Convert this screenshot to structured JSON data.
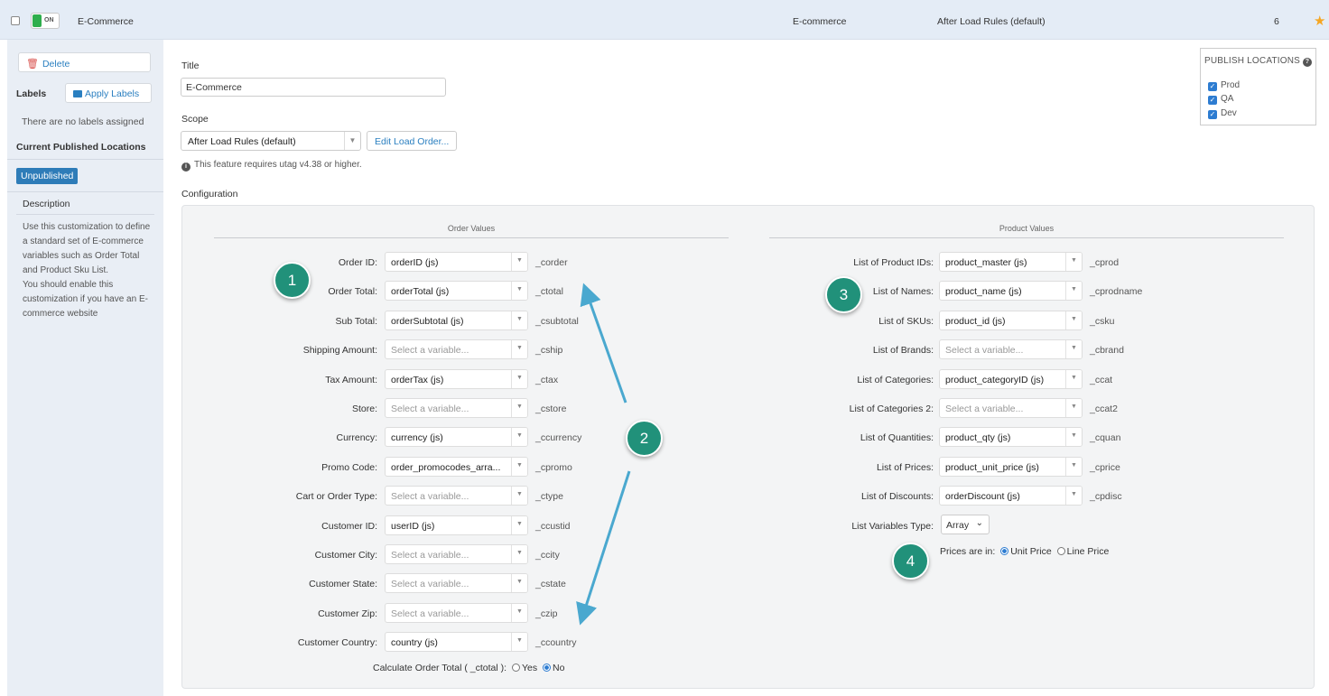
{
  "header": {
    "toggle_label": "ON",
    "name": "E-Commerce",
    "type": "E-commerce",
    "scope": "After Load Rules (default)",
    "number": "6",
    "star_icon": "star-icon"
  },
  "sidebar": {
    "delete_label": "Delete",
    "labels_heading": "Labels",
    "apply_labels": "Apply Labels",
    "no_labels": "There are no labels assigned",
    "current_locations_heading": "Current Published Locations",
    "status_badge": "Unpublished",
    "description_heading": "Description",
    "description": "Use this customization to define a standard set of E-commerce variables such as Order Total and Product Sku List.\nYou should enable this customization if you have an E-commerce website"
  },
  "main": {
    "title_label": "Title",
    "title_value": "E-Commerce",
    "scope_label": "Scope",
    "scope_value": "After Load Rules (default)",
    "edit_load_order": "Edit Load Order...",
    "requirement_note": "This feature requires utag v4.38 or higher.",
    "configuration_label": "Configuration"
  },
  "publish": {
    "title": "PUBLISH LOCATIONS",
    "locations": [
      "Prod",
      "QA",
      "Dev"
    ]
  },
  "order_values": {
    "heading": "Order Values",
    "rows": [
      {
        "label": "Order ID:",
        "value": "orderID (js)",
        "code": "_corder"
      },
      {
        "label": "Order Total:",
        "value": "orderTotal (js)",
        "code": "_ctotal"
      },
      {
        "label": "Sub Total:",
        "value": "orderSubtotal (js)",
        "code": "_csubtotal"
      },
      {
        "label": "Shipping Amount:",
        "value": "Select a variable...",
        "code": "_cship"
      },
      {
        "label": "Tax Amount:",
        "value": "orderTax (js)",
        "code": "_ctax"
      },
      {
        "label": "Store:",
        "value": "Select a variable...",
        "code": "_cstore"
      },
      {
        "label": "Currency:",
        "value": "currency (js)",
        "code": "_ccurrency"
      },
      {
        "label": "Promo Code:",
        "value": "order_promocodes_arra...",
        "code": "_cpromo"
      },
      {
        "label": "Cart or Order Type:",
        "value": "Select a variable...",
        "code": "_ctype"
      },
      {
        "label": "Customer ID:",
        "value": "userID (js)",
        "code": "_ccustid"
      },
      {
        "label": "Customer City:",
        "value": "Select a variable...",
        "code": "_ccity"
      },
      {
        "label": "Customer State:",
        "value": "Select a variable...",
        "code": "_cstate"
      },
      {
        "label": "Customer Zip:",
        "value": "Select a variable...",
        "code": "_czip"
      },
      {
        "label": "Customer Country:",
        "value": "country (js)",
        "code": "_ccountry"
      }
    ],
    "calc_label": "Calculate Order Total ( _ctotal ):",
    "calc_yes": "Yes",
    "calc_no": "No"
  },
  "product_values": {
    "heading": "Product Values",
    "rows": [
      {
        "label": "List of Product IDs:",
        "value": "product_master (js)",
        "code": "_cprod"
      },
      {
        "label": "List of Names:",
        "value": "product_name (js)",
        "code": "_cprodname"
      },
      {
        "label": "List of SKUs:",
        "value": "product_id (js)",
        "code": "_csku"
      },
      {
        "label": "List of Brands:",
        "value": "Select a variable...",
        "code": "_cbrand"
      },
      {
        "label": "List of Categories:",
        "value": "product_categoryID (js)",
        "code": "_ccat"
      },
      {
        "label": "List of Categories 2:",
        "value": "Select a variable...",
        "code": "_ccat2"
      },
      {
        "label": "List of Quantities:",
        "value": "product_qty (js)",
        "code": "_cquan"
      },
      {
        "label": "List of Prices:",
        "value": "product_unit_price (js)",
        "code": "_cprice"
      },
      {
        "label": "List of Discounts:",
        "value": "orderDiscount (js)",
        "code": "_cpdisc"
      }
    ],
    "list_type_label": "List Variables Type:",
    "list_type_value": "Array",
    "prices_label": "Prices are in:",
    "unit_price": "Unit Price",
    "line_price": "Line Price"
  },
  "annotations": [
    "1",
    "2",
    "3",
    "4"
  ],
  "colors": {
    "accent": "#2a7fc0",
    "badge": "#21917a",
    "arrow": "#4aa8cf",
    "toggle_on": "#2eae4c",
    "star": "#f5a623"
  }
}
